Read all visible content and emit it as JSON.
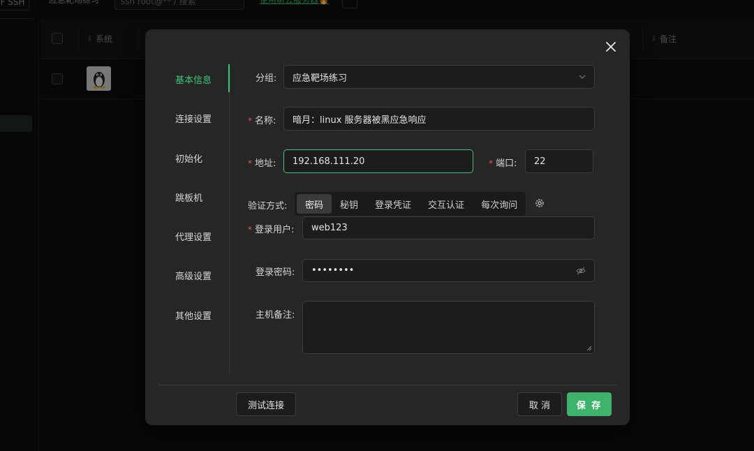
{
  "background": {
    "ssh_button": "F SSH",
    "group_label": "应急靶场练习",
    "search_placeholder": "ssh root@** / 搜索",
    "top_link": "使用前去服务器🔥",
    "columns": [
      {
        "label": "系统"
      },
      {
        "label": "备注"
      }
    ],
    "row": {
      "os": "linux-tux-icon"
    }
  },
  "modal": {
    "nav": [
      {
        "label": "基本信息",
        "active": true
      },
      {
        "label": "连接设置",
        "active": false
      },
      {
        "label": "初始化",
        "active": false
      },
      {
        "label": "跳板机",
        "active": false
      },
      {
        "label": "代理设置",
        "active": false
      },
      {
        "label": "高级设置",
        "active": false
      },
      {
        "label": "其他设置",
        "active": false
      }
    ],
    "form": {
      "group": {
        "label": "分组:",
        "value": "应急靶场练习"
      },
      "name": {
        "label": "名称:",
        "value": "暗月：linux 服务器被黑应急响应"
      },
      "address": {
        "label": "地址:",
        "value": "192.168.111.20"
      },
      "port": {
        "label": "端口:",
        "value": "22"
      },
      "auth": {
        "label": "验证方式:",
        "options": [
          "密码",
          "秘钥",
          "登录凭证",
          "交互认证",
          "每次询问"
        ],
        "selected": "密码"
      },
      "user": {
        "label": "登录用户:",
        "value": "web123"
      },
      "password": {
        "label": "登录密码:",
        "value": "••••••••"
      },
      "note": {
        "label": "主机备注:",
        "value": ""
      }
    },
    "buttons": {
      "test": "测试连接",
      "cancel": "取 消",
      "save": "保 存"
    }
  },
  "colors": {
    "accent": "#3fb26b",
    "required": "#e05555",
    "modal_bg": "#262626"
  }
}
